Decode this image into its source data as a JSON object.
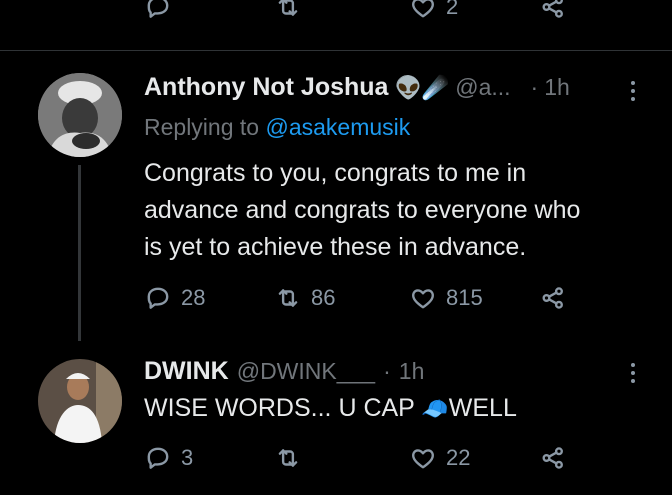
{
  "top_tweet": {
    "actions": {
      "reply_count": "",
      "retweet_count": "",
      "like_count": "2"
    }
  },
  "tweet1": {
    "author_name": "Anthony Not Joshua",
    "author_emojis": "👽☄️",
    "handle": "@a...",
    "separator": "·",
    "time": "1h",
    "replying_prefix": "Replying to",
    "replying_to": "@asakemusik",
    "text_line1": "Congrats to you, congrats to me in",
    "text_line2": "advance and congrats to everyone who",
    "text_line3": "is yet to achieve these in advance.",
    "actions": {
      "reply_count": "28",
      "retweet_count": "86",
      "like_count": "815"
    }
  },
  "tweet2": {
    "author_name": "DWINK",
    "handle": "@DWINK___",
    "separator": "·",
    "time": "1h",
    "text_before": "WISE WORDS... U CAP",
    "cap_emoji": "🧢",
    "text_after": "WELL",
    "actions": {
      "reply_count": "3",
      "retweet_count": "",
      "like_count": "22"
    }
  },
  "colors": {
    "background": "#000000",
    "text": "#e7e9ea",
    "muted": "#71767b",
    "link": "#1d9bf0",
    "divider": "#2f3336"
  },
  "icons": [
    "reply-icon",
    "retweet-icon",
    "like-icon",
    "share-icon",
    "more-icon"
  ]
}
